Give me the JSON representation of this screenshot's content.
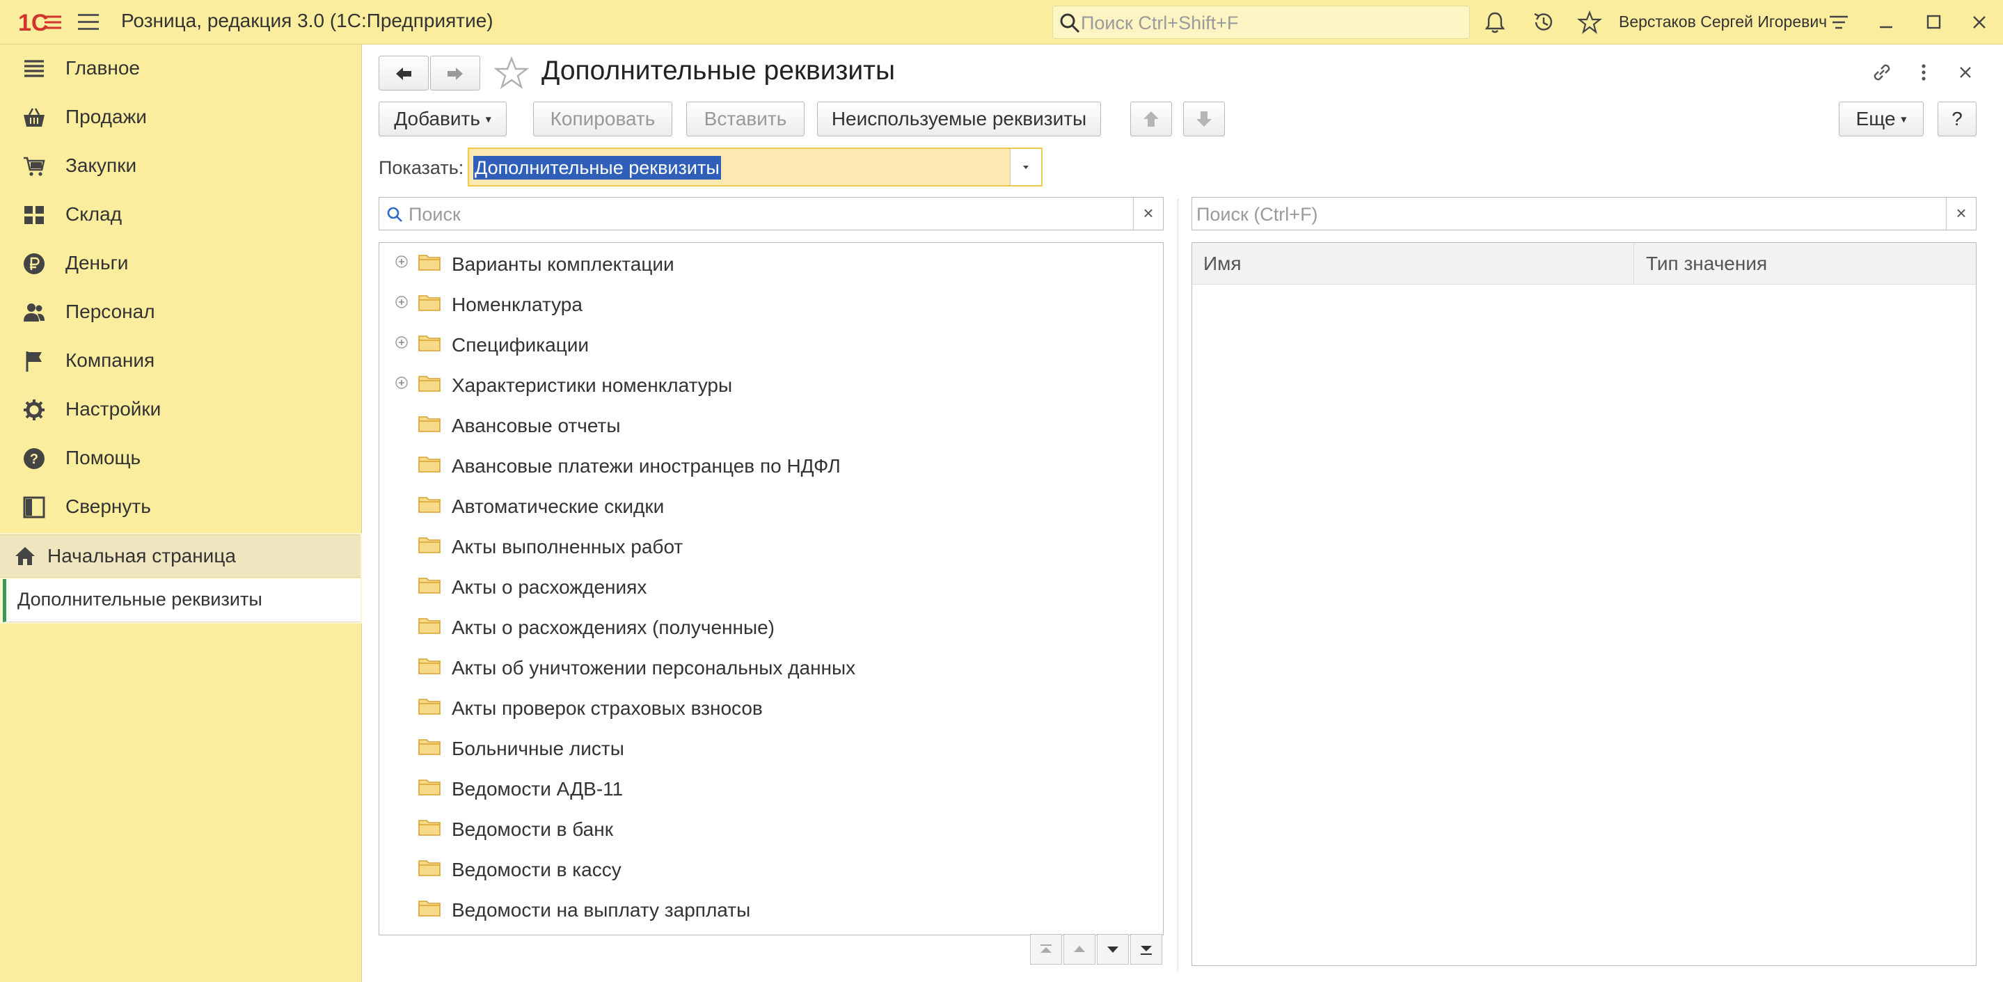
{
  "titlebar": {
    "logo_text": "1С",
    "app_title": "Розница, редакция 3.0  (1С:Предприятие)",
    "search_placeholder": "Поиск Ctrl+Shift+F",
    "user_name": "Верстаков Сергей Игоревич",
    "icons": [
      "menu-icon",
      "search-icon",
      "bell-icon",
      "history-icon",
      "star-icon",
      "settings-icon",
      "minimize-icon",
      "maximize-icon",
      "close-icon"
    ]
  },
  "sidebar": {
    "items": [
      {
        "label": "Главное",
        "icon": "list-icon"
      },
      {
        "label": "Продажи",
        "icon": "basket-icon"
      },
      {
        "label": "Закупки",
        "icon": "cart-icon"
      },
      {
        "label": "Склад",
        "icon": "warehouse-icon"
      },
      {
        "label": "Деньги",
        "icon": "ruble-icon"
      },
      {
        "label": "Персонал",
        "icon": "people-icon"
      },
      {
        "label": "Компания",
        "icon": "flag-icon"
      },
      {
        "label": "Настройки",
        "icon": "gear-icon"
      },
      {
        "label": "Помощь",
        "icon": "help-icon"
      },
      {
        "label": "Свернуть",
        "icon": "collapse-icon"
      }
    ],
    "home_label": "Начальная страница",
    "active_doc_label": "Дополнительные реквизиты"
  },
  "form": {
    "title": "Дополнительные реквизиты",
    "toolbar": {
      "add": "Добавить",
      "copy": "Копировать",
      "paste": "Вставить",
      "unused": "Неиспользуемые реквизиты",
      "more": "Еще",
      "help": "?"
    },
    "show_label": "Показать:",
    "show_value": "Дополнительные реквизиты",
    "left_search_placeholder": "Поиск",
    "right_search_placeholder": "Поиск (Ctrl+F)",
    "clear_symbol": "×",
    "tree": [
      {
        "label": "Варианты комплектации",
        "expandable": true
      },
      {
        "label": "Номенклатура",
        "expandable": true
      },
      {
        "label": "Спецификации",
        "expandable": true
      },
      {
        "label": "Характеристики номенклатуры",
        "expandable": true
      },
      {
        "label": "Авансовые отчеты",
        "expandable": false
      },
      {
        "label": "Авансовые платежи иностранцев по НДФЛ",
        "expandable": false
      },
      {
        "label": "Автоматические скидки",
        "expandable": false
      },
      {
        "label": "Акты выполненных работ",
        "expandable": false
      },
      {
        "label": "Акты о расхождениях",
        "expandable": false
      },
      {
        "label": "Акты о расхождениях (полученные)",
        "expandable": false
      },
      {
        "label": "Акты об уничтожении персональных данных",
        "expandable": false
      },
      {
        "label": "Акты проверок страховых взносов",
        "expandable": false
      },
      {
        "label": "Больничные листы",
        "expandable": false
      },
      {
        "label": "Ведомости АДВ-11",
        "expandable": false
      },
      {
        "label": "Ведомости в банк",
        "expandable": false
      },
      {
        "label": "Ведомости в кассу",
        "expandable": false
      },
      {
        "label": "Ведомости на выплату зарплаты",
        "expandable": false
      }
    ],
    "table_columns": [
      "Имя",
      "Тип значения"
    ]
  },
  "colors": {
    "titlebar_bg": "#fbed9e",
    "sidebar_bg": "#fbed9e",
    "active_marker": "#3a9a52",
    "selection_bg": "#2f5fb8",
    "field_bg": "#fbe8b2",
    "folder": "#f2c14e",
    "logo_red": "#d0342c"
  }
}
